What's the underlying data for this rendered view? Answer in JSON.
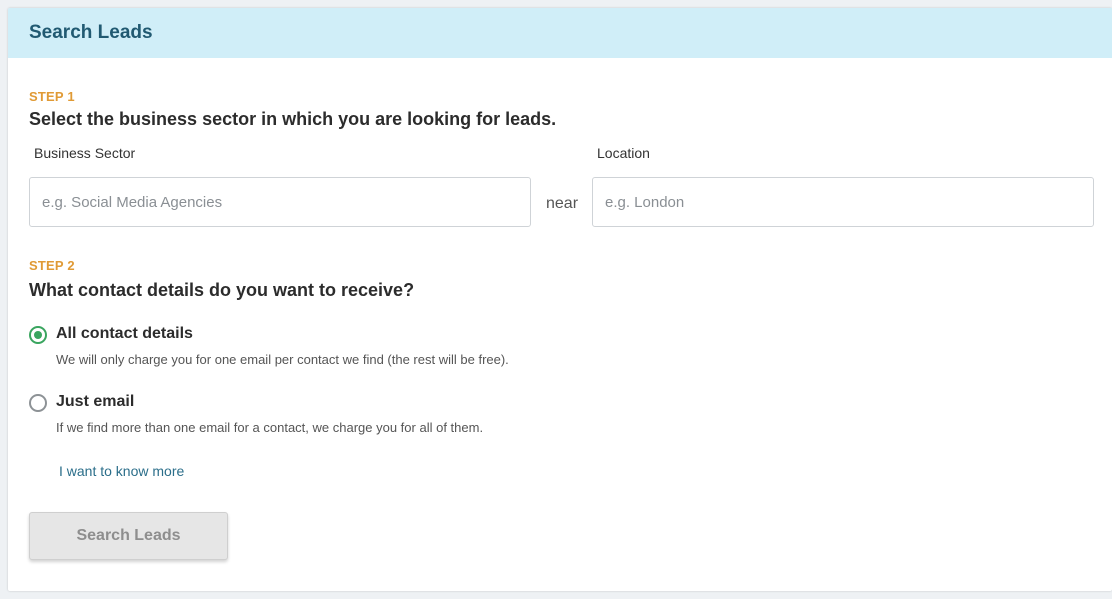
{
  "header": {
    "title": "Search Leads"
  },
  "step1": {
    "label": "STEP 1",
    "question": "Select the business sector in which you are looking for leads.",
    "sector": {
      "label": "Business Sector",
      "placeholder": "e.g. Social Media Agencies",
      "value": ""
    },
    "near_text": "near",
    "location": {
      "label": "Location",
      "placeholder": "e.g. London",
      "value": ""
    }
  },
  "step2": {
    "label": "STEP 2",
    "question": "What contact details do you want to receive?",
    "options": [
      {
        "title": "All contact details",
        "description": "We will only charge you for one email per contact we find (the rest will be free).",
        "selected": true
      },
      {
        "title": "Just email",
        "description": "If we find more than one email for a contact, we charge you for all of them.",
        "selected": false
      }
    ],
    "more_link": "I want to know more"
  },
  "submit": {
    "label": "Search Leads"
  },
  "colors": {
    "header_bg": "#d0eef8",
    "title": "#215a72",
    "step_accent": "#e09a35",
    "radio_selected": "#3aa55f",
    "link": "#2b6e8a"
  }
}
